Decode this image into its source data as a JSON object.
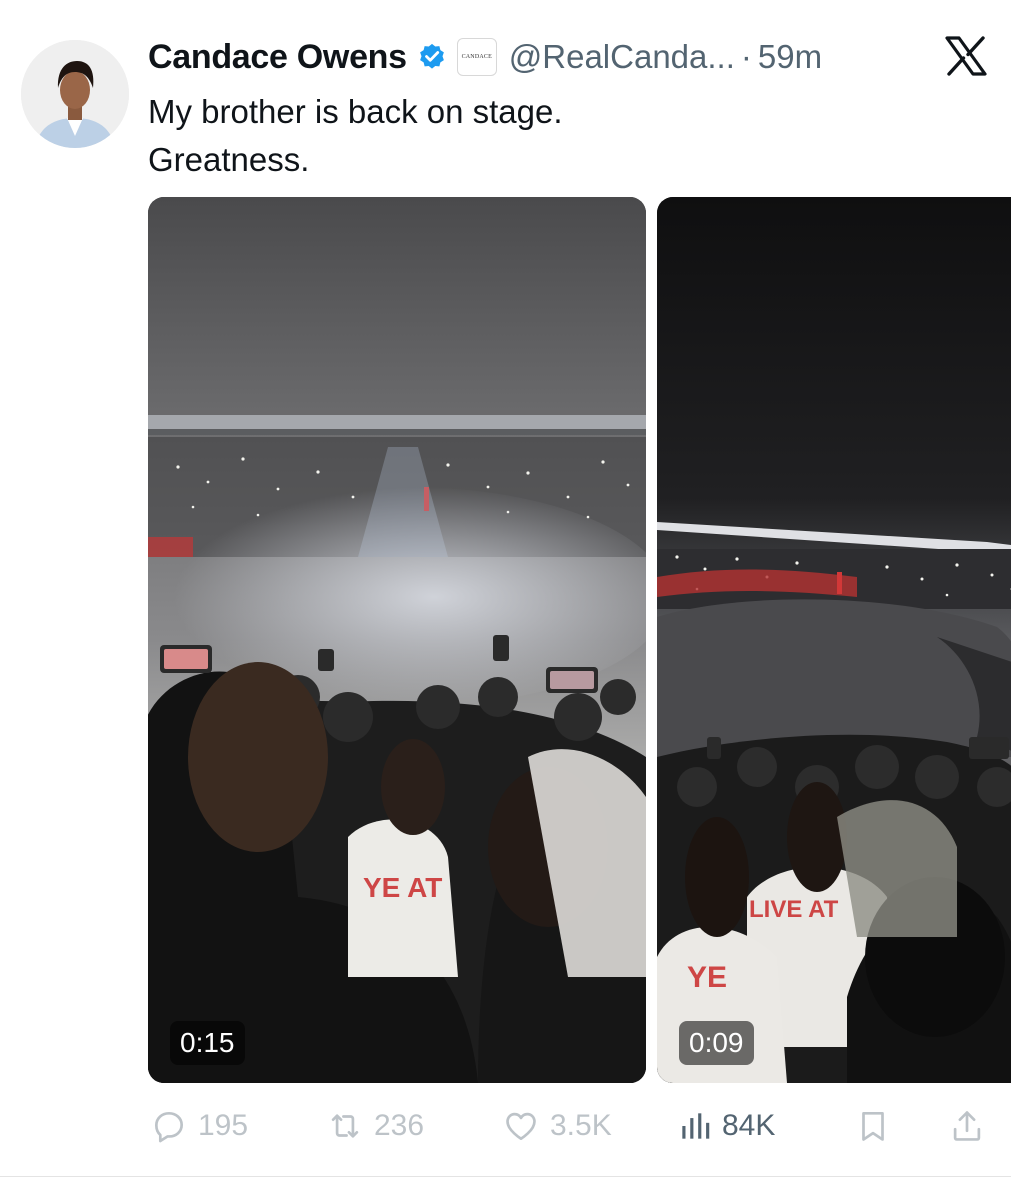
{
  "author": {
    "display_name": "Candace Owens",
    "handle": "@RealCanda...",
    "separator": "·",
    "timestamp": "59m",
    "affiliate_badge_text": "CANDACE"
  },
  "tweet": {
    "lines": [
      "My brother is back on stage.",
      "Greatness."
    ]
  },
  "media": [
    {
      "duration": "0:15"
    },
    {
      "duration": "0:09"
    }
  ],
  "actions": {
    "replies": "195",
    "reposts": "236",
    "likes": "3.5K",
    "views": "84K"
  },
  "colors": {
    "verified_blue": "#1d9bf0",
    "secondary_text": "#536471",
    "primary_text": "#0f1419"
  }
}
